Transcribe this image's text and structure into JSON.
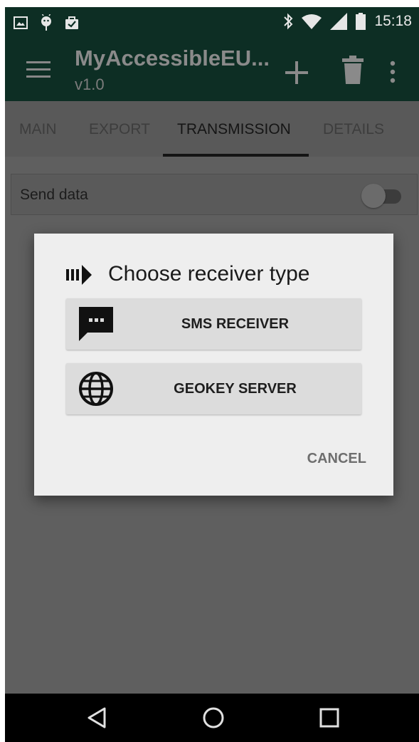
{
  "status_bar": {
    "time": "15:18",
    "icons": [
      "image-icon",
      "android-icon",
      "bag-check-icon",
      "bluetooth-icon",
      "wifi-icon",
      "signal-icon",
      "battery-icon"
    ]
  },
  "app_bar": {
    "title": "MyAccessibleEU...",
    "subtitle": "v1.0",
    "actions": [
      "menu-icon",
      "add-icon",
      "delete-icon",
      "overflow-icon"
    ]
  },
  "tabs": [
    {
      "label": "MAIN",
      "active": false
    },
    {
      "label": "EXPORT",
      "active": false
    },
    {
      "label": "TRANSMISSION",
      "active": true
    },
    {
      "label": "DETAILS",
      "active": false
    }
  ],
  "settings": {
    "send_data": {
      "label": "Send data",
      "enabled": false
    }
  },
  "dialog": {
    "title": "Choose receiver type",
    "title_icon": "receiver-arrow-icon",
    "options": [
      {
        "label": "SMS RECEIVER",
        "icon": "sms-icon"
      },
      {
        "label": "GEOKEY SERVER",
        "icon": "globe-icon"
      }
    ],
    "cancel_label": "CANCEL"
  },
  "nav_bar": {
    "buttons": [
      "back-icon",
      "home-icon",
      "recents-icon"
    ]
  },
  "colors": {
    "app_bar": "#0d2e24",
    "scrim_background": "#5f5f5f",
    "dialog_background": "#eeeeee",
    "option_background": "#dcdcdc"
  }
}
